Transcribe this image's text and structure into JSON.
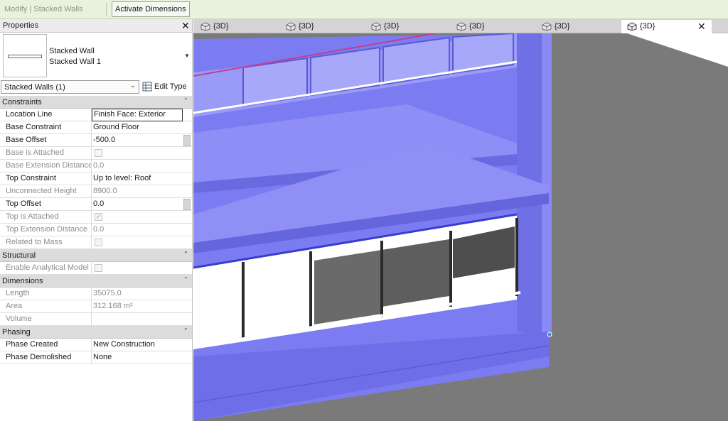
{
  "ribbon": {
    "context_label": "Modify | Stacked Walls",
    "activate_dimensions": "Activate Dimensions"
  },
  "properties": {
    "title": "Properties",
    "type_family": "Stacked Wall",
    "type_name": "Stacked Wall 1",
    "filter": "Stacked Walls (1)",
    "edit_type": "Edit Type",
    "groups": {
      "constraints": "Constraints",
      "structural": "Structural",
      "dimensions": "Dimensions",
      "phasing": "Phasing"
    },
    "rows": {
      "location_line": {
        "label": "Location Line",
        "value": "Finish Face: Exterior"
      },
      "base_constraint": {
        "label": "Base Constraint",
        "value": "Ground Floor"
      },
      "base_offset": {
        "label": "Base Offset",
        "value": "-500.0"
      },
      "base_attached": {
        "label": "Base is Attached"
      },
      "base_ext": {
        "label": "Base Extension Distance",
        "value": "0.0"
      },
      "top_constraint": {
        "label": "Top Constraint",
        "value": "Up to level: Roof"
      },
      "unconnected": {
        "label": "Unconnected Height",
        "value": "8900.0"
      },
      "top_offset": {
        "label": "Top Offset",
        "value": "0.0"
      },
      "top_attached": {
        "label": "Top is Attached"
      },
      "top_ext": {
        "label": "Top Extension Distance",
        "value": "0.0"
      },
      "related_mass": {
        "label": "Related to Mass"
      },
      "analytical": {
        "label": "Enable Analytical Model"
      },
      "length": {
        "label": "Length",
        "value": "35075.0"
      },
      "area": {
        "label": "Area",
        "value": "312.168 m²"
      },
      "volume": {
        "label": "Volume",
        "value": ""
      },
      "phase_created": {
        "label": "Phase Created",
        "value": "New Construction"
      },
      "phase_demolished": {
        "label": "Phase Demolished",
        "value": "None"
      }
    }
  },
  "tabs": [
    "{3D}",
    "{3D}",
    "{3D}",
    "{3D}",
    "{3D}",
    "{3D}"
  ],
  "colors": {
    "ribbon_bg": "#e9f2dd",
    "selection_blue": "#7b7bf0",
    "viewport_bg": "#7a7a7a"
  }
}
